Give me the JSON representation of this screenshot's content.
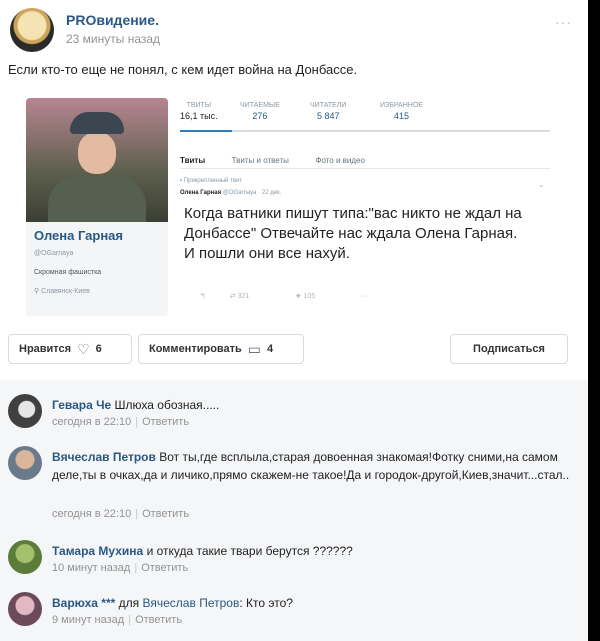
{
  "post": {
    "author": "PROвидение.",
    "time": "23 минуты назад",
    "more": "···",
    "text": "Если кто-то еще не понял, с кем идет война на Донбассе."
  },
  "embedded_tweet": {
    "profile": {
      "name": "Олена Гарная",
      "handle": "@OGarnaya",
      "bio": "Скромная фашистка",
      "location": "Славянск-Киев"
    },
    "stats": [
      {
        "label": "ТВИТЫ",
        "value": "16,1 тыс."
      },
      {
        "label": "ЧИТАЕМЫЕ",
        "value": "276"
      },
      {
        "label": "ЧИТАТЕЛИ",
        "value": "5 847"
      },
      {
        "label": "ИЗБРАННОЕ",
        "value": "415"
      }
    ],
    "tabs": [
      "Твиты",
      "Твиты и ответы",
      "Фото и видео"
    ],
    "pinned_label": "Прикрепленный твит",
    "tweet_author": "Олена Гарная",
    "tweet_meta": "@OGarnaya · 22 дек.",
    "tweet_text": "Когда ватники пишут типа:\"вас никто не ждал на Донбассе\" Отвечайте нас ждала Олена Гарная. И пошли они все нахуй.",
    "retweets": "321",
    "favorites": "105"
  },
  "actions": {
    "like_label": "Нравится",
    "like_count": "6",
    "comment_label": "Комментировать",
    "comment_count": "4",
    "subscribe_label": "Подписаться"
  },
  "comments": [
    {
      "name": "Гевара Че",
      "text": "Шлюха обозная.....",
      "time": "сегодня в 22:10",
      "reply": "Ответить"
    },
    {
      "name": "Вячеслав Петров",
      "text": "Вот ты,где всплыла,старая довоенная знакомая!Фотку сними,на самом деле,ты в очках,да и личико,прямо скажем-не такое!Да и городок-другой,Киев,значит...стал..",
      "time": "сегодня в 22:10",
      "reply": "Ответить"
    },
    {
      "name": "Тамара Мухина",
      "text": "и откуда такие твари берутся ??????",
      "time": "10 минут назад",
      "reply": "Ответить"
    },
    {
      "name": "Варюха ***",
      "to_word": "для",
      "to_name": "Вячеслав Петров",
      "text": "Кто это?",
      "time": "9 минут назад",
      "reply": "Ответить"
    }
  ]
}
